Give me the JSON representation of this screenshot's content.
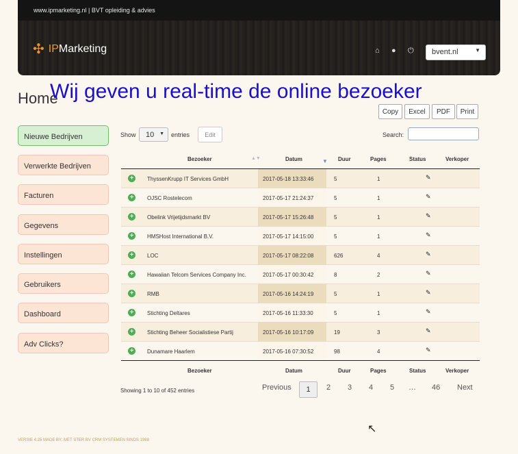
{
  "header": {
    "site_text": "www.ipmarketing.nl | BVT opleiding & advies",
    "logo_ip": "IP",
    "logo_rest": "Marketing",
    "domain_value": "bvent.nl"
  },
  "overlay_text": "Wij geven u real-time de online bezoeker",
  "page_title": "Home",
  "export_buttons": [
    "Copy",
    "Excel",
    "PDF",
    "Print"
  ],
  "sidebar": {
    "items": [
      {
        "label": "Nieuwe Bedrijven",
        "active": true
      },
      {
        "label": "Verwerkte Bedrijven"
      },
      {
        "label": "Facturen"
      },
      {
        "label": "Gegevens"
      },
      {
        "label": "Instellingen"
      },
      {
        "label": "Gebruikers"
      },
      {
        "label": "Dashboard"
      },
      {
        "label": "Adv Clicks?"
      }
    ]
  },
  "controls": {
    "show_label": "Show",
    "entries_value": "10",
    "entries_label": "entries",
    "edit_label": "Edit",
    "search_label": "Search:",
    "search_value": ""
  },
  "table": {
    "columns": [
      "Bezoeker",
      "Datum",
      "Duur",
      "Pages",
      "Status",
      "Verkoper"
    ],
    "rows": [
      {
        "bezoeker": "ThyssenKrupp IT Services GmbH",
        "datum": "2017-05-18 13:33:46",
        "duur": "5",
        "pages": "1"
      },
      {
        "bezoeker": "OJSC Rostelecom",
        "datum": "2017-05-17 21:24:37",
        "duur": "5",
        "pages": "1"
      },
      {
        "bezoeker": "Obelink Vrijetijdsmarkt BV",
        "datum": "2017-05-17 15:26:48",
        "duur": "5",
        "pages": "1"
      },
      {
        "bezoeker": "HMSHost International B.V.",
        "datum": "2017-05-17 14:15:00",
        "duur": "5",
        "pages": "1"
      },
      {
        "bezoeker": "LOC",
        "datum": "2017-05-17 08:22:08",
        "duur": "626",
        "pages": "4"
      },
      {
        "bezoeker": "Hawaiian Telcom Services Company Inc.",
        "datum": "2017-05-17 00:30:42",
        "duur": "8",
        "pages": "2"
      },
      {
        "bezoeker": "RMB",
        "datum": "2017-05-16 14:24:19",
        "duur": "5",
        "pages": "1"
      },
      {
        "bezoeker": "Stichting Deltares",
        "datum": "2017-05-16 11:33:30",
        "duur": "5",
        "pages": "1"
      },
      {
        "bezoeker": "Stichting Beheer Socialistiese Partij",
        "datum": "2017-05-16 10:17:09",
        "duur": "19",
        "pages": "3"
      },
      {
        "bezoeker": "Dunamare Haarlem",
        "datum": "2017-05-16 07:30:52",
        "duur": "98",
        "pages": "4"
      }
    ],
    "info": "Showing 1 to 10 of 452 entries"
  },
  "pagination": {
    "previous": "Previous",
    "pages": [
      "1",
      "2",
      "3",
      "4",
      "5",
      "…",
      "46"
    ],
    "current": "1",
    "next": "Next"
  },
  "footer": "VERSIE 4.25 MADE BY: MET STER BV CRM SYSTEMEN SINDS 1988",
  "icons": {
    "home": "home-icon",
    "user": "user-icon",
    "power": "power-icon",
    "row_expand": "plus-circle-icon",
    "status_edit": "pencil-icon"
  },
  "colors": {
    "overlay": "#1a10c8",
    "active_item": "#d7f0d4",
    "sidebar_item": "#fde5d6",
    "logo_accent": "#f39a2e"
  }
}
